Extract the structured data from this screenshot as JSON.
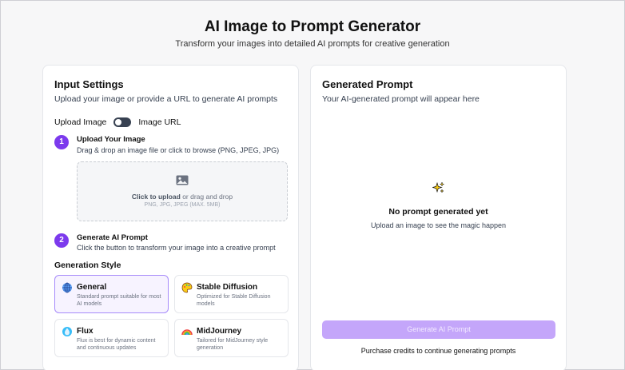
{
  "header": {
    "title": "AI Image to Prompt Generator",
    "subtitle": "Transform your images into detailed AI prompts for creative generation"
  },
  "input_settings": {
    "title": "Input Settings",
    "description": "Upload your image or provide a URL to generate AI prompts",
    "toggle": {
      "left_label": "Upload Image",
      "right_label": "Image URL",
      "state": "upload"
    },
    "step1": {
      "number": "1",
      "title": "Upload Your Image",
      "description": "Drag & drop an image file or click to browse (PNG, JPEG, JPG)"
    },
    "dropzone": {
      "click_text": "Click to upload",
      "rest_text": " or drag and drop",
      "hint": "PNG, JPG, JPEG (MAX. 5MB)",
      "icon": "image-icon"
    },
    "step2": {
      "number": "2",
      "title": "Generate AI Prompt",
      "description": "Click the button to transform your image into a creative prompt"
    },
    "style_label": "Generation Style",
    "styles": [
      {
        "name": "General",
        "desc": "Standard prompt suitable for most AI models",
        "icon": "globe-icon",
        "selected": true
      },
      {
        "name": "Stable Diffusion",
        "desc": "Optimized for Stable Diffusion models",
        "icon": "palette-icon",
        "selected": false
      },
      {
        "name": "Flux",
        "desc": "Flux is best for dynamic content and continuous updates",
        "icon": "droplet-icon",
        "selected": false
      },
      {
        "name": "MidJourney",
        "desc": "Tailored for MidJourney style generation",
        "icon": "rainbow-icon",
        "selected": false
      }
    ]
  },
  "generated_prompt": {
    "title": "Generated Prompt",
    "description": "Your AI-generated prompt will appear here",
    "empty_icon": "sparkle-icon",
    "empty_title": "No prompt generated yet",
    "empty_description": "Upload an image to see the magic happen",
    "button_label": "Generate AI Prompt",
    "purchase_text": "Purchase credits to continue generating prompts"
  },
  "colors": {
    "accent": "#7c3aed",
    "button_disabled": "#c4a6fa",
    "selected_border": "#a78bfa"
  }
}
